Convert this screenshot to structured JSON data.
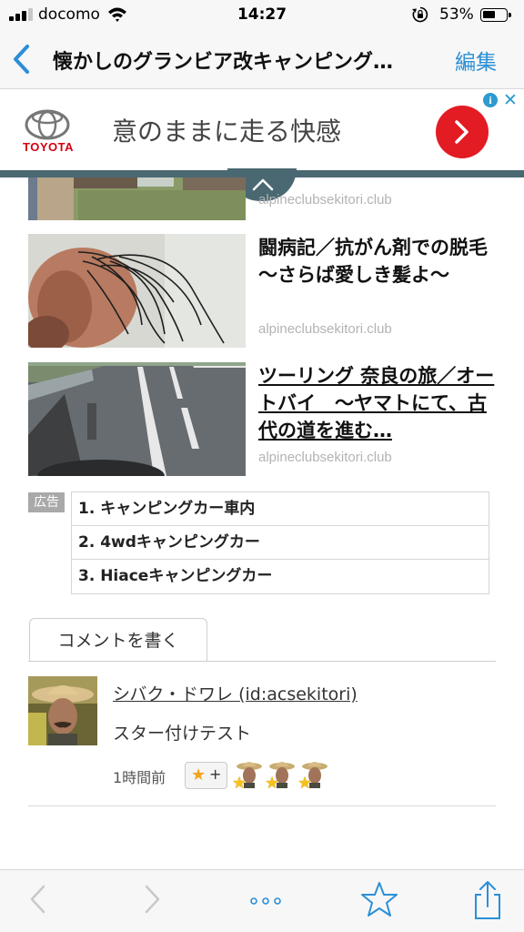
{
  "status_bar": {
    "carrier": "docomo",
    "time": "14:27",
    "battery_percent": "53%",
    "battery_level": 0.53,
    "icons": [
      "signal-icon",
      "wifi-icon",
      "orientation-lock-icon",
      "battery-icon"
    ]
  },
  "nav": {
    "title": "懐かしのグランビア改キャンピング…",
    "edit_label": "編集"
  },
  "ad_banner": {
    "brand": "TOYOTA",
    "text": "意のままに走る快感",
    "brand_color": "#d40012",
    "button_color": "#e31b23"
  },
  "articles": [
    {
      "title": "",
      "source": "alpineclubsekitori.club"
    },
    {
      "title": "闘病記／抗がん剤での脱毛 〜さらば愛しき髪よ〜",
      "source": "alpineclubsekitori.club"
    },
    {
      "title": "ツーリング 奈良の旅／オートバイ　〜ヤマトにて、古代の道を進む…",
      "source": "alpineclubsekitori.club"
    }
  ],
  "related": {
    "ad_label": "広告",
    "items": [
      "1. キャンピングカー車内",
      "2. 4wdキャンピングカー",
      "3. Hiaceキャンピングカー"
    ]
  },
  "comments": {
    "write_label": "コメントを書く",
    "items": [
      {
        "author": "シバク・ドワレ (id:acsekitori)",
        "body": "スター付けテスト",
        "time": "1時間前",
        "add_star_label": "+",
        "star_count": 3
      }
    ]
  },
  "toolbar": {
    "icons": [
      "back-arrow-icon",
      "forward-arrow-icon",
      "more-dots-icon",
      "star-icon",
      "share-icon"
    ],
    "accent_color": "#2b8fd6"
  }
}
